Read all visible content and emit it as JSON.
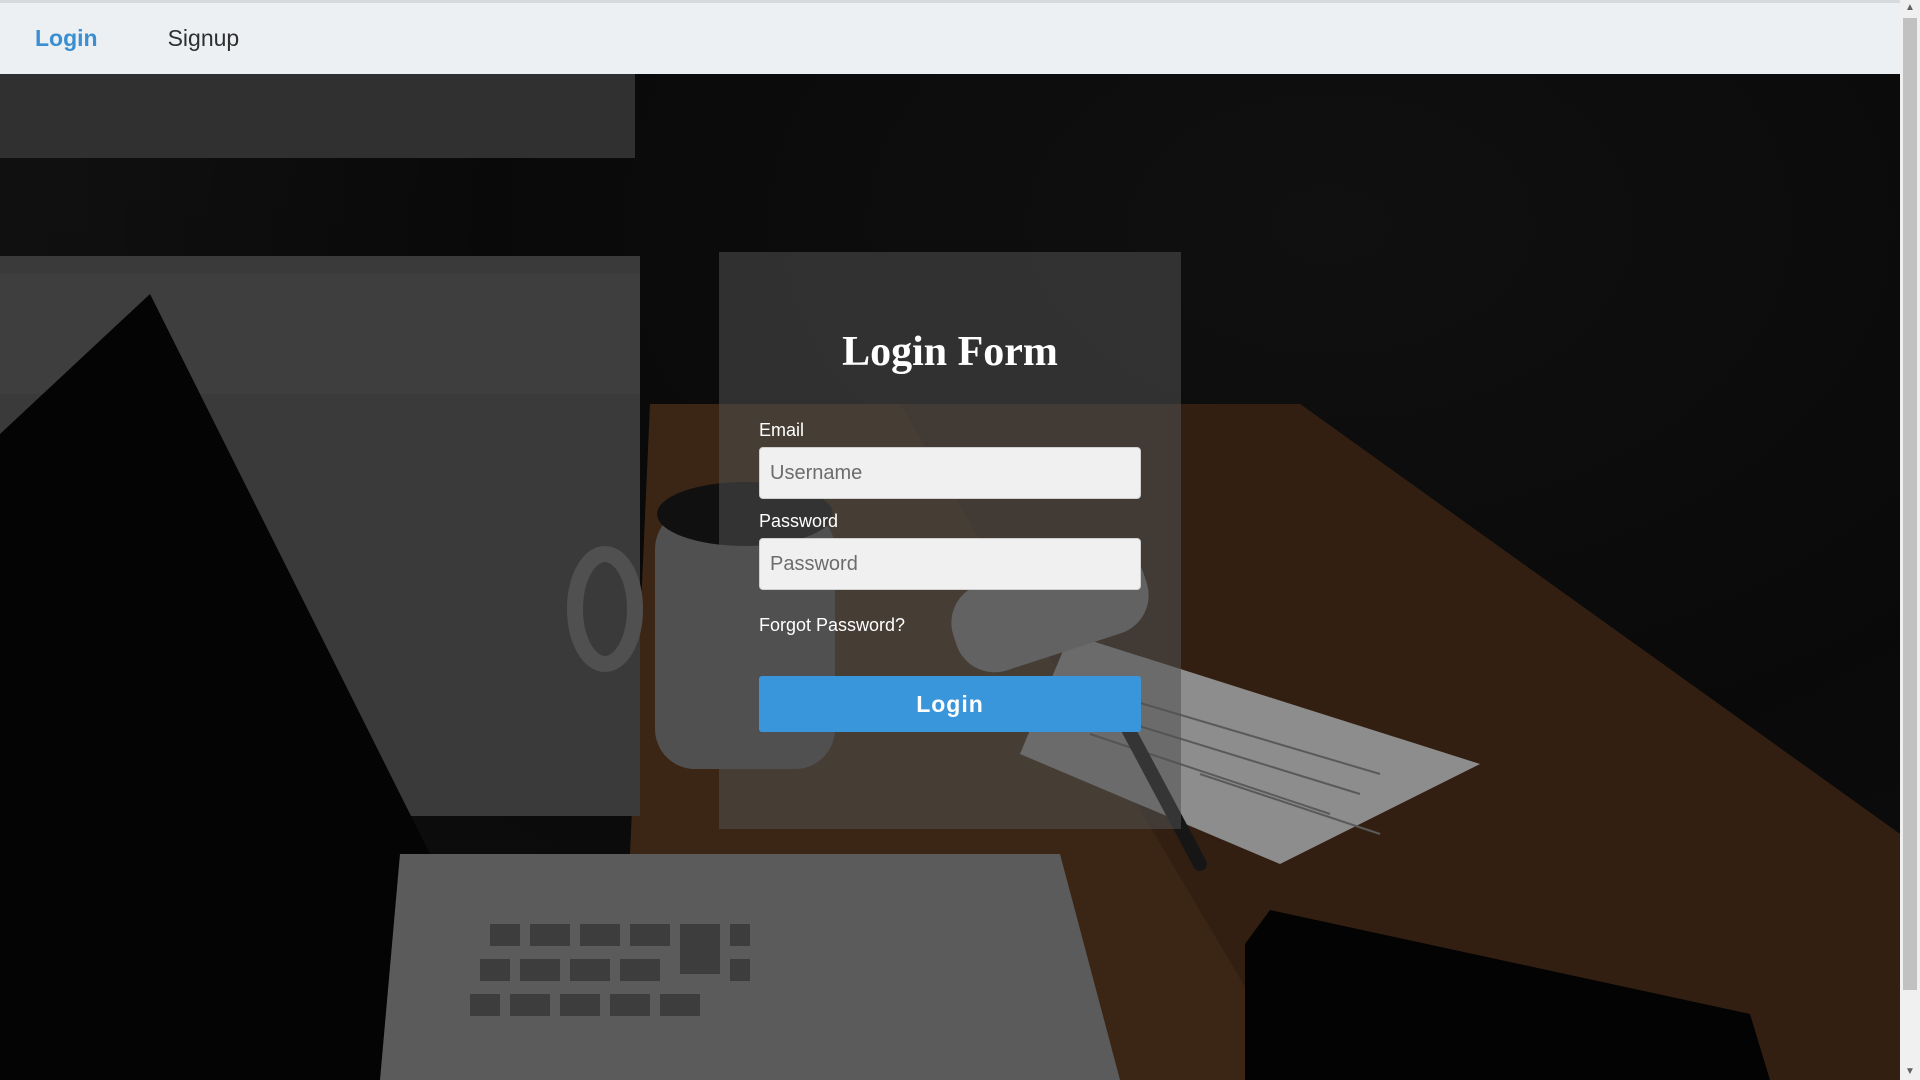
{
  "nav": {
    "login_label": "Login",
    "signup_label": "Signup"
  },
  "form": {
    "title": "Login Form",
    "email_label": "Email",
    "email_placeholder": "Username",
    "email_value": "",
    "password_label": "Password",
    "password_placeholder": "Password",
    "password_value": "",
    "forgot_label": "Forgot Password?",
    "submit_label": "Login"
  },
  "colors": {
    "accent": "#3a96db",
    "nav_active": "#3a8fd2",
    "nav_background": "#edf0f3",
    "card_background": "rgba(80,80,80,0.55)"
  },
  "icons": {
    "scroll_up": "scroll-up-arrow-icon",
    "scroll_down": "scroll-down-arrow-icon"
  }
}
